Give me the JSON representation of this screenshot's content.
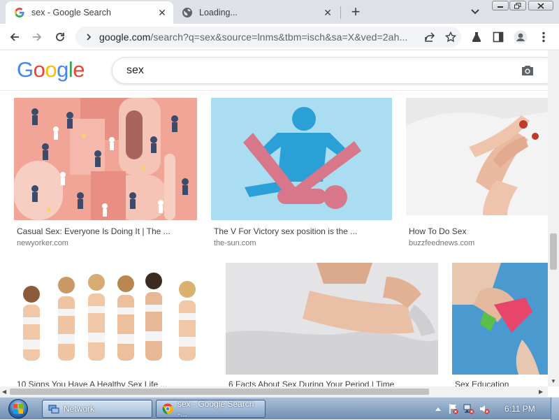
{
  "browser": {
    "tabs": [
      {
        "title": "sex - Google Search",
        "favicon": "google-g-icon",
        "active": true
      },
      {
        "title": "Loading...",
        "favicon": "globe-icon",
        "active": false
      }
    ],
    "url_host": "google.com",
    "url_path": "/search?q=sex&source=lnms&tbm=isch&sa=X&ved=2ah..."
  },
  "google": {
    "logo_letters": [
      "G",
      "o",
      "o",
      "g",
      "l",
      "e"
    ],
    "logo_colors": [
      "#4285F4",
      "#EA4335",
      "#FBBC05",
      "#4285F4",
      "#34A853",
      "#EA4335"
    ],
    "query": "sex"
  },
  "results": [
    {
      "caption": "Casual Sex: Everyone Is Doing It | The ...",
      "source": "newyorker.com"
    },
    {
      "caption": "The V For Victory sex position is the ...",
      "source": "the-sun.com"
    },
    {
      "caption": "How To Do Sex",
      "source": "buzzfeednews.com"
    },
    {
      "caption": "10 Signs You Have A Healthy Sex Life ...",
      "source": ""
    },
    {
      "caption": "6 Facts About Sex During Your Period | Time",
      "source": ""
    },
    {
      "caption": "Sex Education",
      "source": ""
    }
  ],
  "taskbar": {
    "items": [
      {
        "label": "Network",
        "icon": "network-folder-icon"
      },
      {
        "label": "sex - Google Search -...",
        "icon": "chrome-icon"
      }
    ],
    "clock": "6:11 PM"
  },
  "colors": {
    "chrome_frame": "#dee1e6",
    "omnibox_bg": "#f1f3f4",
    "taskbar_top": "#a9bfd6",
    "taskbar_bottom": "#6f8fb3"
  }
}
